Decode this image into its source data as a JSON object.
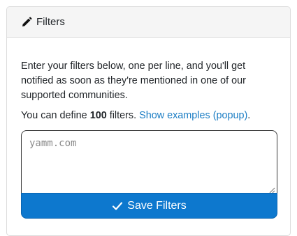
{
  "header": {
    "title": "Filters",
    "icon": "pencil-icon"
  },
  "body": {
    "description": "Enter your filters below, one per line, and you'll get notified as soon as they're mentioned in one of our supported communities.",
    "limit_prefix": "You can define ",
    "limit_count": "100",
    "limit_suffix": " filters. ",
    "examples_link": "Show examples (popup)",
    "limit_end": "."
  },
  "form": {
    "placeholder": "yamm.com",
    "value": "",
    "save_label": "Save Filters",
    "save_icon": "check-icon"
  },
  "colors": {
    "accent": "#0d78ce",
    "link": "#1b7dc4",
    "header_bg": "#f5f5f5"
  }
}
